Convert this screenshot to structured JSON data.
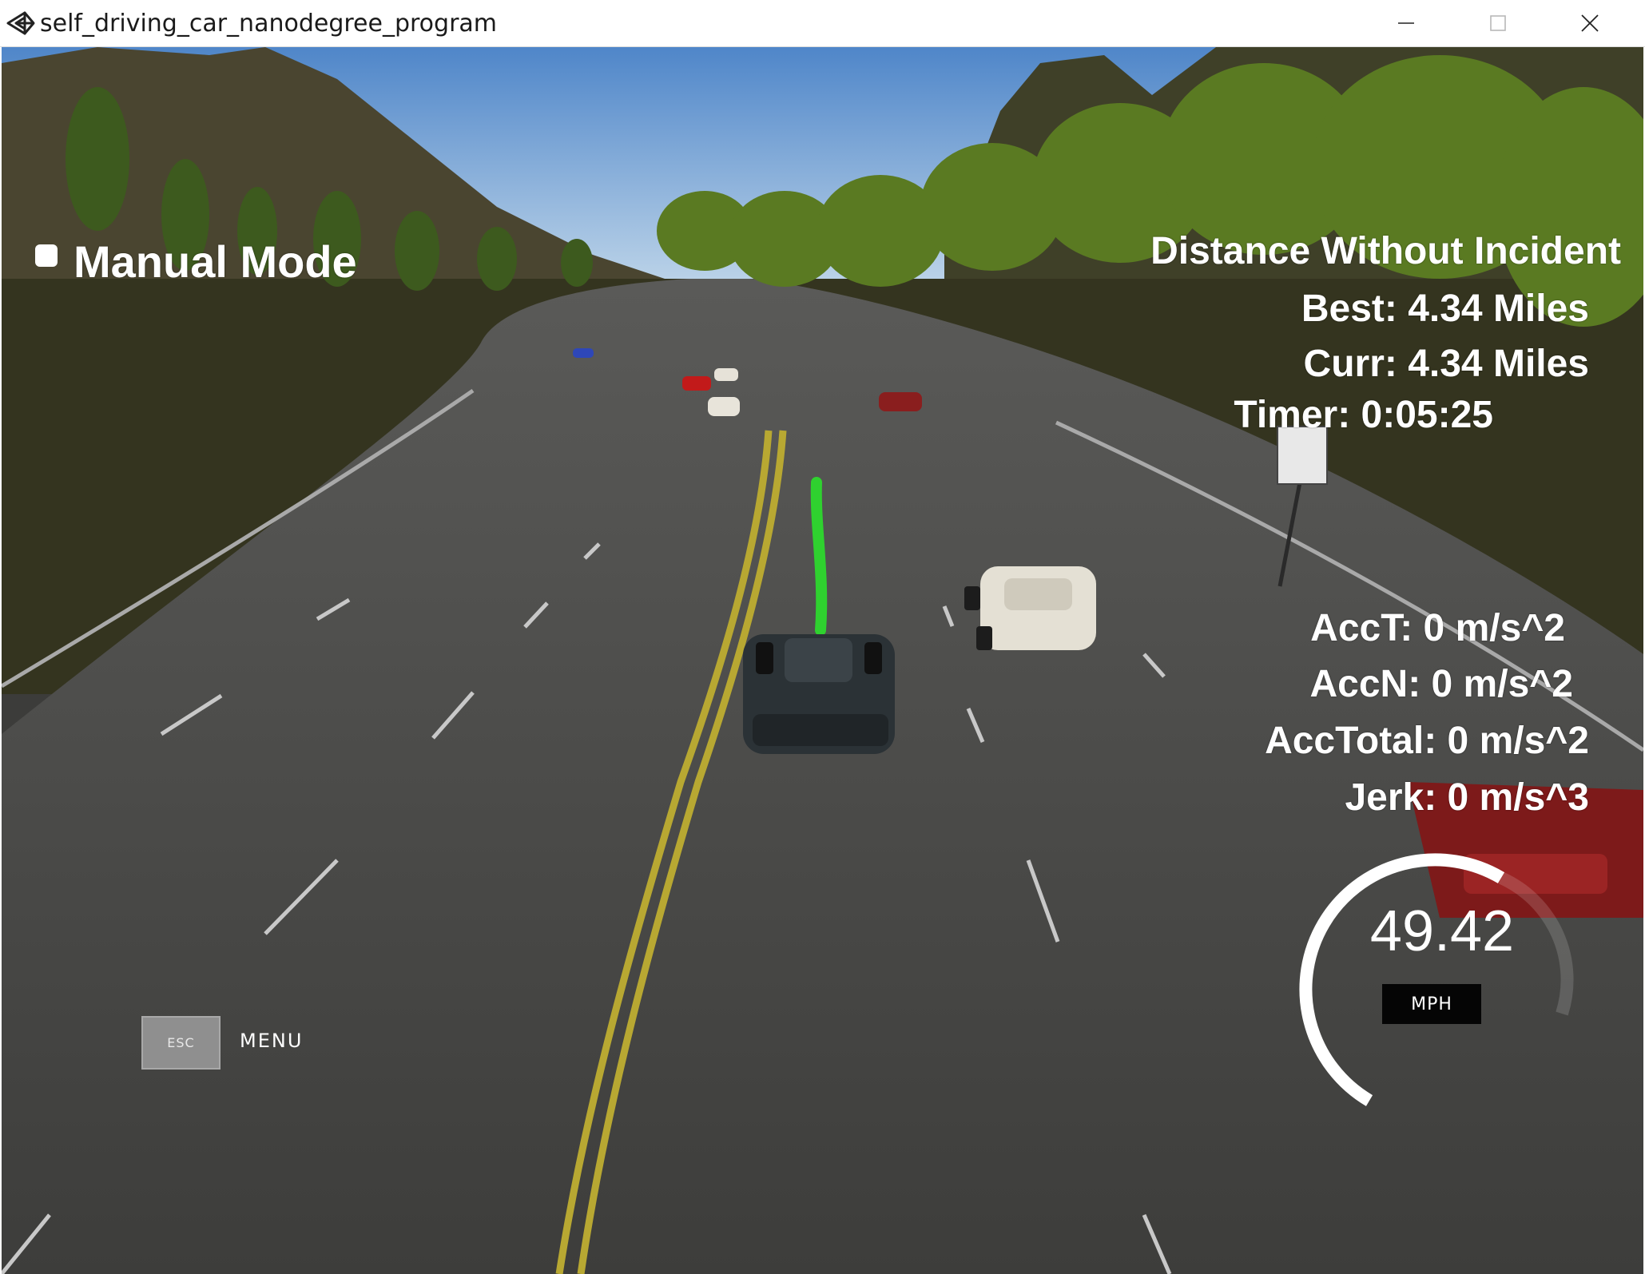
{
  "window": {
    "title": "self_driving_car_nanodegree_program",
    "icons": {
      "app": "unity-logo-icon",
      "minimize": "minimize-icon",
      "maximize": "maximize-icon",
      "close": "close-icon"
    }
  },
  "hud": {
    "mode_label": "Manual Mode",
    "distance_title": "Distance Without Incident",
    "best": "Best: 4.34 Miles",
    "curr": "Curr: 4.34 Miles",
    "timer": "Timer: 0:05:25",
    "acc_t": "AccT: 0 m/s^2",
    "acc_n": "AccN: 0 m/s^2",
    "acc_total": "AccTotal: 0 m/s^2",
    "jerk": "Jerk: 0 m/s^3"
  },
  "speedometer": {
    "value": "49.42",
    "unit": "MPH"
  },
  "menu": {
    "key_label": "ESC",
    "label": "MENU"
  },
  "colors": {
    "sky": "#6e9fd6",
    "road": "#4a4a48",
    "grass": "#3a3a22",
    "trajectory": "#2fd12f",
    "lane_yellow": "#c8b52a"
  }
}
